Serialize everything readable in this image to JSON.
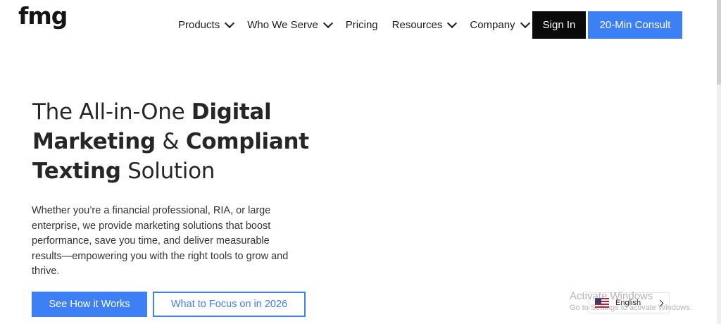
{
  "header": {
    "logo_text": "fmg",
    "nav": [
      {
        "label": "Products",
        "has_dropdown": true
      },
      {
        "label": "Who We Serve",
        "has_dropdown": true
      },
      {
        "label": "Pricing",
        "has_dropdown": false
      },
      {
        "label": "Resources",
        "has_dropdown": true
      },
      {
        "label": "Company",
        "has_dropdown": true
      }
    ],
    "sign_in_label": "Sign In",
    "consult_label": "20-Min Consult"
  },
  "hero": {
    "title_parts": [
      {
        "text": "The All-in-One ",
        "bold": false
      },
      {
        "text": "Digital Marketing",
        "bold": true
      },
      {
        "text": " & ",
        "bold": false
      },
      {
        "text": "Compliant Texting",
        "bold": true
      },
      {
        "text": " Solution",
        "bold": false
      }
    ],
    "description": "Whether you’re a financial professional, RIA, or large enterprise, we provide marketing solutions that boost performance, save you time, and deliver measurable results—empowering you with the right tools to grow and thrive.",
    "primary_button": "See How it Works",
    "secondary_button": "What to Focus on in 2026"
  },
  "language_widget": {
    "label": "English",
    "flag_icon": "us-flag-icon"
  },
  "os_watermark": {
    "title": "Activate Windows",
    "subtitle": "Go to Settings to activate Windows."
  },
  "colors": {
    "accent_blue": "#3d7ff5",
    "signin_bg": "#0a0a0a",
    "text_dark": "#262626"
  }
}
